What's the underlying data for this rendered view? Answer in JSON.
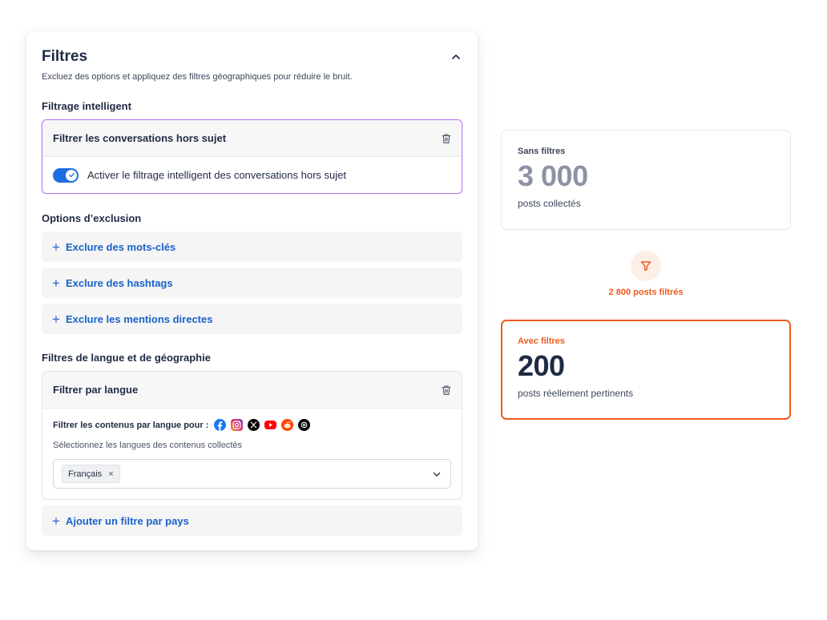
{
  "colors": {
    "accent_blue": "#1a62c9",
    "accent_orange": "#ec5b1f",
    "smart_border": "#b57cf0",
    "muted_number": "#8c93a5",
    "dark_number": "#1f2a44"
  },
  "panel": {
    "title": "Filtres",
    "subtitle": "Excluez des options et appliquez des filtres géographiques pour réduire le bruit.",
    "collapse_icon": "chevron-up-icon"
  },
  "smart": {
    "section_label": "Filtrage intelligent",
    "box_title": "Filtrer les conversations hors sujet",
    "toggle_label": "Activer le filtrage intelligent des conversations hors sujet",
    "toggle_on": true
  },
  "exclusion": {
    "section_label": "Options d’exclusion",
    "buttons": [
      "Exclure des mots-clés",
      "Exclure des hashtags",
      "Exclure les mentions directes"
    ]
  },
  "language": {
    "section_label": "Filtres de langue et de géographie",
    "box_title": "Filtrer par langue",
    "filter_line": "Filtrer les contenus par langue pour :",
    "networks": [
      "facebook-icon",
      "instagram-icon",
      "x-icon",
      "youtube-icon",
      "reddit-icon",
      "threads-icon"
    ],
    "hint": "Sélectionnez les langues des contenus collectés",
    "selected": [
      "Français"
    ],
    "remove_glyph": "×",
    "add_country": "Ajouter un filtre par pays"
  },
  "stats": {
    "without": {
      "label": "Sans filtres",
      "value": "3 000",
      "desc": "posts collectés"
    },
    "filtered": "2 800 posts filtrés",
    "with": {
      "label": "Avec filtres",
      "value": "200",
      "desc": "posts réellement pertinents"
    }
  }
}
